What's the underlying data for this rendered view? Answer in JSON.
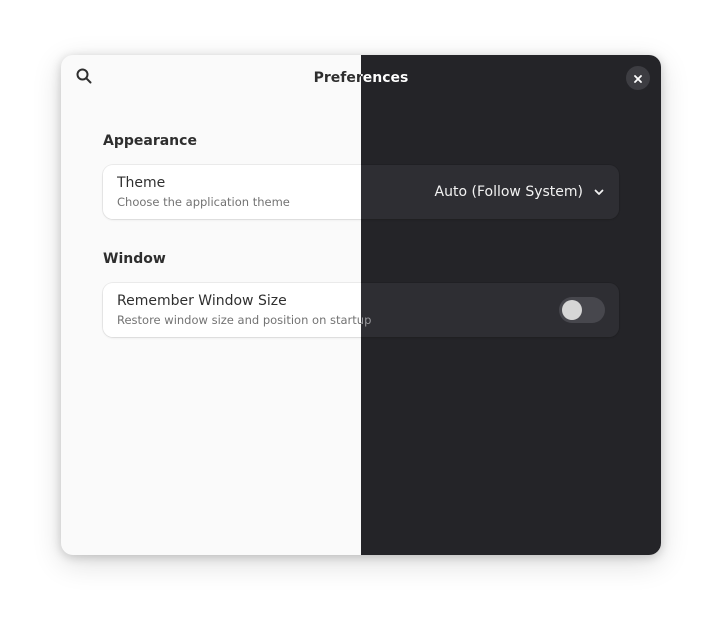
{
  "window": {
    "title": "Preferences"
  },
  "icons": {
    "search": "search-icon",
    "close": "close-icon",
    "dropdown": "chevron-down-icon"
  },
  "sections": {
    "appearance": {
      "title": "Appearance",
      "theme_row": {
        "title": "Theme",
        "subtitle": "Choose the application theme",
        "selected_value": "Auto (Follow System)"
      }
    },
    "window": {
      "title": "Window",
      "remember_size_row": {
        "title": "Remember Window Size",
        "subtitle": "Restore window size and position on startup",
        "enabled": false
      }
    }
  },
  "colors": {
    "light_bg": "#fafafa",
    "dark_bg": "#242428",
    "light_row": "#ffffff",
    "dark_row": "#2e2e33",
    "toggle_off": "#47474d"
  }
}
